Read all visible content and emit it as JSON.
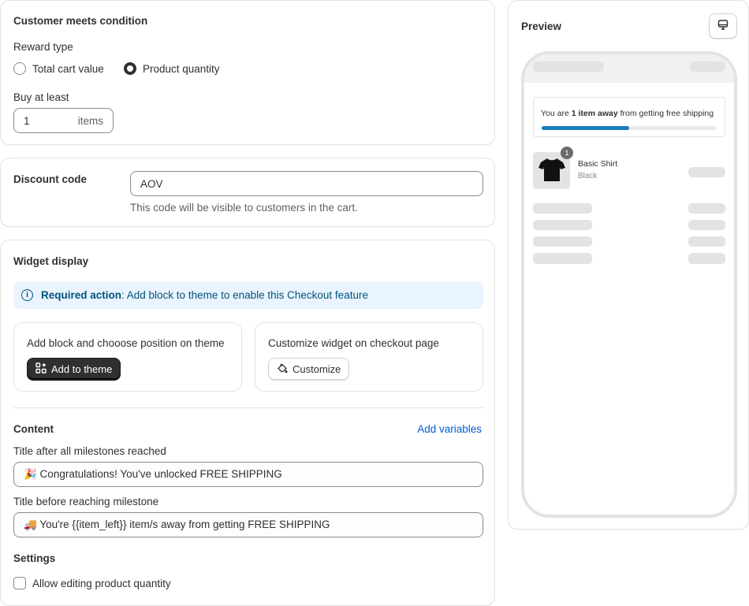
{
  "condition": {
    "title": "Customer meets condition",
    "reward_type_label": "Reward type",
    "options": [
      {
        "label": "Total cart value",
        "checked": false
      },
      {
        "label": "Product quantity",
        "checked": true
      }
    ],
    "buy_at_least_label": "Buy at least",
    "quantity_value": "1",
    "quantity_suffix": "items"
  },
  "discount": {
    "title": "Discount code",
    "code_value": "AOV",
    "help_text": "This code will be visible to customers in the cart."
  },
  "widget": {
    "title": "Widget display",
    "banner_strong": "Required action",
    "banner_text": ": Add block to theme to enable this Checkout feature",
    "theme_box_title": "Add block and chooose position on theme",
    "theme_button_label": "Add to theme",
    "customize_box_title": "Customize widget on checkout page",
    "customize_button_label": "Customize",
    "content_title": "Content",
    "add_variables_label": "Add variables",
    "after_label": "Title after all milestones reached",
    "after_value": "🎉 Congratulations! You've unlocked FREE SHIPPING",
    "before_label": "Title before reaching milestone",
    "before_value": "🚚 You're {{item_left}} item/s away from getting FREE SHIPPING",
    "settings_title": "Settings",
    "allow_edit_label": "Allow editing product quantity",
    "allow_edit_checked": false
  },
  "preview": {
    "title": "Preview",
    "progress_prefix": "You are ",
    "progress_bold": "1 item away",
    "progress_suffix": " from getting free shipping",
    "progress_fraction": 0.5,
    "product_name": "Basic Shirt",
    "product_variant": "Black",
    "product_qty": "1"
  },
  "colors": {
    "accent_link": "#005bd3",
    "banner_bg": "#eaf4ff",
    "progress_fill": "#1c7bbc",
    "primary_button": "#303030"
  }
}
